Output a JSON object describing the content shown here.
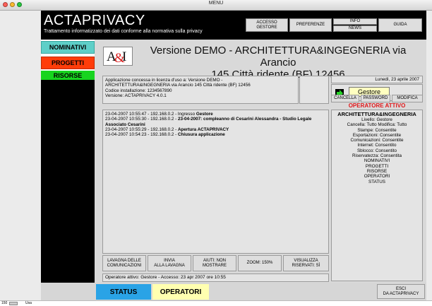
{
  "window": {
    "title": "MENU"
  },
  "header": {
    "app_name": "ACTAPRIVACY",
    "subtitle": "Trattamento informatizzato dei dati conforme alla normativa sulla privacy",
    "buttons": {
      "accesso": [
        "ACCESSO",
        "GESTORE"
      ],
      "preferenze": "PREFERENZE",
      "info": "INFO",
      "news": "NEWS",
      "guida": "GUIDA"
    }
  },
  "nav": {
    "nominativi": "NOMINATIVI",
    "progetti": "PROGETTI",
    "risorse": "RISORSE"
  },
  "colors": {
    "nominativi": "#5ecfc8",
    "progetti": "#ff3c0a",
    "risorse": "#17d41f",
    "header": "#000000",
    "operatore": "#e0181a",
    "gestore_btn": "#ffffc0",
    "status": "#2aa3e6",
    "operatori": "#ffffb0"
  },
  "logo": {
    "text": "A&I"
  },
  "version": {
    "line1": "Versione DEMO - ARCHITETTURA&INGEGNERIA via Arancio",
    "line2": "145 Città ridente (BF) 12456"
  },
  "license": {
    "line1": "Applicazione concessa in licenza d'uso a: Versione DEMO -",
    "line2": "ARCHITETTURA&INGEGNERIA via Arancio 145 Città ridente (BF) 12456",
    "line3": "Codice installazione: 1234567890",
    "line4": "Versione: ACTAPRIVACY 4.0.1"
  },
  "date": "Lunedì, 23 aprile 2007",
  "gestore_button": "Gestore",
  "actions": {
    "cancella": "CANCELLA",
    "password": "PASSWORD",
    "modifica": "MODIFICA"
  },
  "operatore": {
    "header": "OPERATORE ATTIVO",
    "name": "ARCHITETTURA&INGEGNERIA",
    "lines": [
      "Livello: Gestore",
      "Cancella: Tutto Modifica: Tutto",
      "Stampe: Consentite",
      "Esportazioni: Consentite",
      "Comunicazioni: Consentite",
      "Internet: Consentito",
      "Sblocco: Consentito",
      "Riservatezza: Consentita",
      "NOMINATIVI",
      "PROGETTI",
      "RISORSE",
      "OPERATORI",
      "STATUS"
    ]
  },
  "log": [
    {
      "prefix": "23-04-2007 10:55:47 - 192.168.0.2 - Ingresso ",
      "bold": "Gestore",
      "cont": ""
    },
    {
      "prefix": "23-04-2007 10:55:30 - 192.168.0.2 - ",
      "bold": "23-04-2007: compleanno di Cesarini Alessandra - Studio Legale",
      "cont": "Associato Cesarini"
    },
    {
      "prefix": "23-04-2007 10:55:29 - 192.168.0.2 - ",
      "bold": "Apertura ACTAPRIVACY",
      "cont": ""
    },
    {
      "prefix": "23-04-2007 10:54:23 - 192.168.0.2 - ",
      "bold": "Chiusura applicazione",
      "cont": ""
    }
  ],
  "lavagna": {
    "b1": [
      "LAVAGNA DELLE",
      "COMUNICAZIONI"
    ],
    "b2": [
      "INVIA",
      "ALLA LAVAGNA"
    ],
    "b3": [
      "AIUTI: NON",
      "MOSTRARE"
    ],
    "b4": "ZOOM: 150%",
    "b5": [
      "VISUALIZZA",
      "RISERVATI: SÌ"
    ]
  },
  "status_text": "Operatore attivo: Gestore - Accesso: 23 apr 2007 ore 10:55",
  "bottom": {
    "status": "STATUS",
    "operatori": "OPERATORI",
    "esci": [
      "ESCI",
      "DA ACTAPRIVACY"
    ]
  },
  "statusbar": {
    "zoom": "150",
    "mode": "Usa"
  }
}
